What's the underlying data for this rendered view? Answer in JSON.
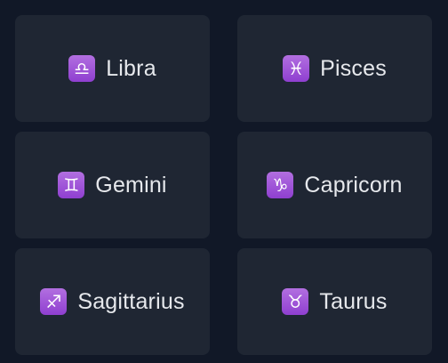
{
  "tiles": [
    {
      "label": "Libra",
      "glyph": "♎︎",
      "icon": "libra-icon"
    },
    {
      "label": "Pisces",
      "glyph": "♓︎",
      "icon": "pisces-icon"
    },
    {
      "label": "Gemini",
      "glyph": "♊︎",
      "icon": "gemini-icon"
    },
    {
      "label": "Capricorn",
      "glyph": "♑︎",
      "icon": "capricorn-icon"
    },
    {
      "label": "Sagittarius",
      "glyph": "♐︎",
      "icon": "sagittarius-icon"
    },
    {
      "label": "Taurus",
      "glyph": "♉︎",
      "icon": "taurus-icon"
    }
  ],
  "colors": {
    "background": "#111827",
    "tile": "#1f2633",
    "badge": "#9b4fd8",
    "text": "#e6e8ec"
  }
}
